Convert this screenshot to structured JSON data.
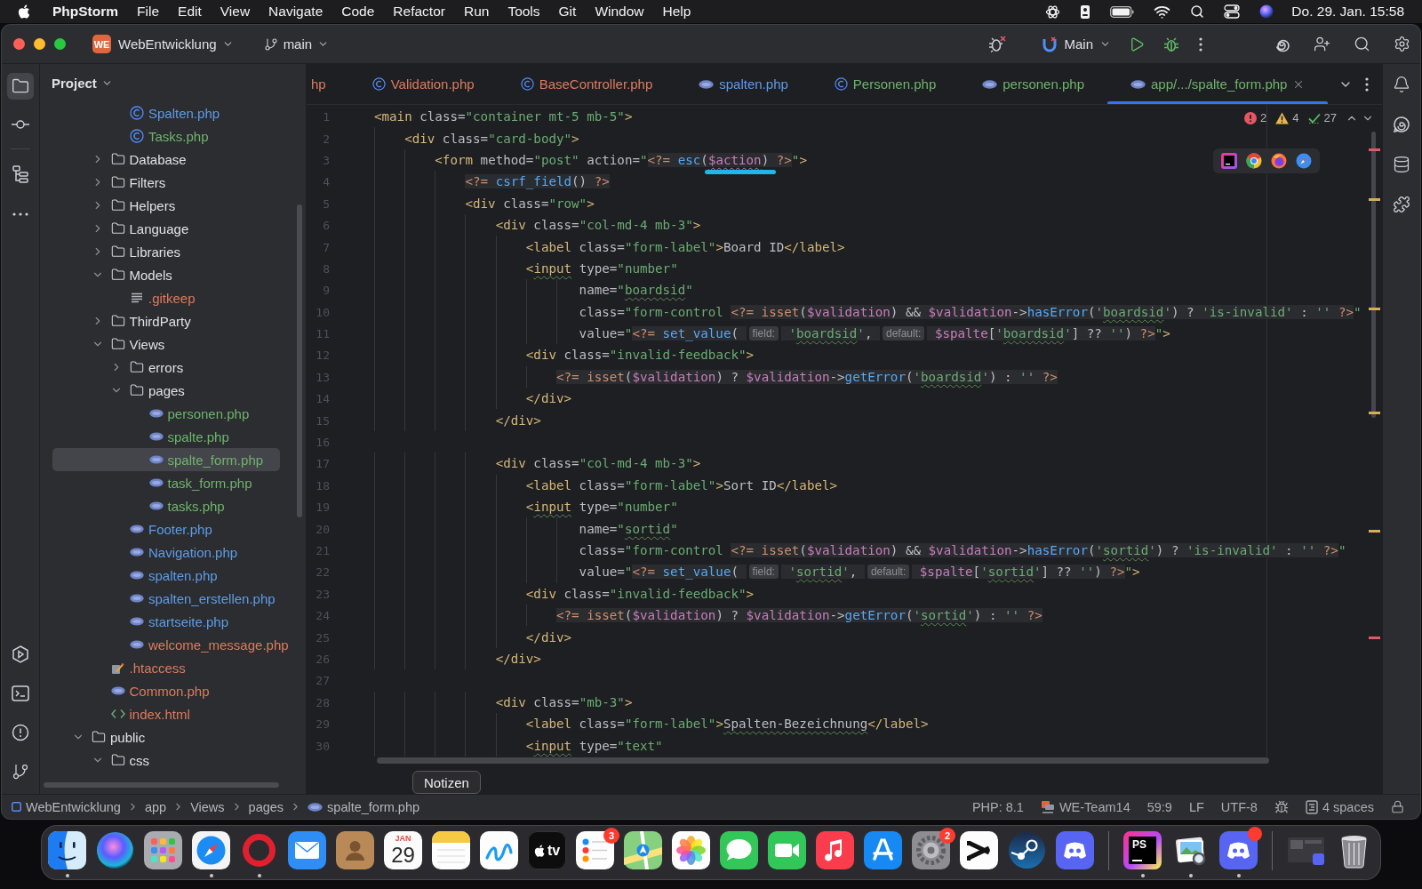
{
  "menu_bar": {
    "app": "PhpStorm",
    "menus": [
      "File",
      "Edit",
      "View",
      "Navigate",
      "Code",
      "Refactor",
      "Run",
      "Tools",
      "Git",
      "Window",
      "Help"
    ],
    "clock": "Do. 29. Jan. 15:58"
  },
  "toolbar": {
    "project_badge": "WE",
    "project": "WebEntwicklung",
    "branch": "main",
    "run_config": "Main"
  },
  "tool_strip_left": {
    "top": [
      {
        "kind": "project",
        "selected": true
      },
      {
        "kind": "commit",
        "selected": false
      },
      {
        "kind": "structure",
        "selected": false
      },
      {
        "kind": "more",
        "selected": false
      }
    ],
    "bottom": [
      {
        "kind": "services",
        "selected": false
      },
      {
        "kind": "terminal",
        "selected": false
      },
      {
        "kind": "problems",
        "selected": false
      },
      {
        "kind": "git",
        "selected": false
      }
    ]
  },
  "project_panel": {
    "title": "Project",
    "tree": [
      {
        "children": [
          {
            "children": [
              {
                "label": "Spalten.php",
                "kind": "class",
                "color": "#5e9ce8",
                "selected": false
              },
              {
                "label": "Tasks.php",
                "kind": "class",
                "color": "#6fb36c",
                "selected": false
              }
            ]
          },
          {
            "label": "Database",
            "kind": "folder",
            "expanded": false,
            "selected": false
          },
          {
            "label": "Filters",
            "kind": "folder",
            "expanded": false,
            "selected": false
          },
          {
            "label": "Helpers",
            "kind": "folder",
            "expanded": false,
            "selected": false
          },
          {
            "label": "Language",
            "kind": "folder",
            "expanded": false,
            "selected": false
          },
          {
            "label": "Libraries",
            "kind": "folder",
            "expanded": false,
            "selected": false
          },
          {
            "label": "Models",
            "kind": "folder",
            "expanded": true,
            "selected": false,
            "children": [
              {
                "label": ".gitkeep",
                "kind": "text",
                "color": "#dc7b5f",
                "selected": false
              }
            ]
          },
          {
            "label": "ThirdParty",
            "kind": "folder",
            "expanded": false,
            "selected": false
          },
          {
            "label": "Views",
            "kind": "folder",
            "expanded": true,
            "selected": false,
            "children": [
              {
                "label": "errors",
                "kind": "folder",
                "expanded": false,
                "selected": false
              },
              {
                "label": "pages",
                "kind": "folder",
                "expanded": true,
                "selected": false,
                "children": [
                  {
                    "label": "personen.php",
                    "kind": "php",
                    "color": "#6fb36c",
                    "selected": false
                  },
                  {
                    "label": "spalte.php",
                    "kind": "php",
                    "color": "#6fb36c",
                    "selected": false
                  },
                  {
                    "label": "spalte_form.php",
                    "kind": "php",
                    "color": "#6fb36c",
                    "selected": true
                  },
                  {
                    "label": "task_form.php",
                    "kind": "php",
                    "color": "#6fb36c",
                    "selected": false
                  },
                  {
                    "label": "tasks.php",
                    "kind": "php",
                    "color": "#6fb36c",
                    "selected": false
                  }
                ]
              },
              {
                "label": "Footer.php",
                "kind": "php",
                "color": "#5e9ce8",
                "selected": false
              },
              {
                "label": "Navigation.php",
                "kind": "php",
                "color": "#5e9ce8",
                "selected": false
              },
              {
                "label": "spalten.php",
                "kind": "php",
                "color": "#5e9ce8",
                "selected": false
              },
              {
                "label": "spalten_erstellen.php",
                "kind": "php",
                "color": "#5e9ce8",
                "selected": false
              },
              {
                "label": "startseite.php",
                "kind": "php",
                "color": "#5e9ce8",
                "selected": false
              },
              {
                "label": "welcome_message.php",
                "kind": "php",
                "color": "#dc7b5f",
                "selected": false
              }
            ]
          },
          {
            "label": ".htaccess",
            "kind": "config",
            "color": "#dc7b5f",
            "selected": false
          },
          {
            "label": "Common.php",
            "kind": "php",
            "color": "#dc7b5f",
            "selected": false
          },
          {
            "label": "index.html",
            "kind": "html",
            "color": "#dc7b5f",
            "selected": false
          }
        ]
      },
      {
        "label": "public",
        "kind": "folder",
        "expanded": true,
        "selected": false,
        "children": [
          {
            "label": "css",
            "kind": "folder",
            "expanded": true,
            "selected": false
          }
        ]
      }
    ]
  },
  "editor": {
    "tabs": [
      {
        "label": "hp",
        "color": "#dc7b5f",
        "selected": false
      },
      {
        "label": "Validation.php",
        "kind": "class",
        "color": "#dc7b5f",
        "selected": false
      },
      {
        "label": "BaseController.php",
        "kind": "class",
        "color": "#dc7b5f",
        "selected": false
      },
      {
        "label": "spalten.php",
        "kind": "php",
        "color": "#5e9ce8",
        "selected": false
      },
      {
        "label": "Personen.php",
        "kind": "class",
        "color": "#6fb36c",
        "selected": false
      },
      {
        "label": "personen.php",
        "kind": "php",
        "color": "#6fb36c",
        "selected": false
      },
      {
        "label": "app/.../spalte_form.php",
        "kind": "php",
        "color": "#6fb36c",
        "selected": true
      }
    ],
    "inspections": {
      "errors": "2",
      "warnings": "4",
      "checks": "27"
    },
    "lines": [
      {
        "number": "1",
        "tokens": [
          {
            "text": "<main",
            "kind": "tag"
          },
          {
            "text": " class=",
            "kind": "attr"
          },
          {
            "text": "\"container mt-5 mb-5\"",
            "kind": "str"
          },
          {
            "text": ">",
            "kind": "tag"
          }
        ]
      },
      {
        "number": "2",
        "tokens": [
          {
            "text": "    <div",
            "kind": "tag"
          },
          {
            "text": " class=",
            "kind": "attr"
          },
          {
            "text": "\"card-body\"",
            "kind": "str"
          },
          {
            "text": ">",
            "kind": "tag"
          }
        ]
      },
      {
        "number": "3",
        "tokens": [
          {
            "text": "        <form",
            "kind": "tag"
          },
          {
            "text": " method=",
            "kind": "attr"
          },
          {
            "text": "\"post\"",
            "kind": "str"
          },
          {
            "text": " action=",
            "kind": "attr"
          },
          {
            "text": "\"",
            "kind": "str"
          },
          {
            "text": "<?= ",
            "kind": "php"
          },
          {
            "text": "esc",
            "kind": "fn"
          },
          {
            "text": "(",
            "kind": "op"
          },
          {
            "text": "$action",
            "kind": "var_found"
          },
          {
            "text": ") ",
            "kind": "op"
          },
          {
            "text": "?>",
            "kind": "php"
          },
          {
            "text": "\"",
            "kind": "str"
          },
          {
            "text": ">",
            "kind": "tag"
          }
        ]
      },
      {
        "number": "4",
        "tokens": [
          {
            "text": "            <?= ",
            "kind": "php"
          },
          {
            "text": "csrf_field",
            "kind": "fn"
          },
          {
            "text": "() ",
            "kind": "op"
          },
          {
            "text": "?>",
            "kind": "php"
          }
        ]
      },
      {
        "number": "5",
        "tokens": [
          {
            "text": "            <div",
            "kind": "tag"
          },
          {
            "text": " class=",
            "kind": "attr"
          },
          {
            "text": "\"row\"",
            "kind": "str"
          },
          {
            "text": ">",
            "kind": "tag"
          }
        ]
      },
      {
        "number": "6",
        "tokens": [
          {
            "text": "                <div",
            "kind": "tag"
          },
          {
            "text": " class=",
            "kind": "attr"
          },
          {
            "text": "\"col-md-4 mb-3\"",
            "kind": "str"
          },
          {
            "text": ">",
            "kind": "tag"
          }
        ]
      },
      {
        "number": "7",
        "tokens": [
          {
            "text": "                    <label",
            "kind": "tag"
          },
          {
            "text": " class=",
            "kind": "attr"
          },
          {
            "text": "\"form-label\"",
            "kind": "str"
          },
          {
            "text": ">",
            "kind": "tag"
          },
          {
            "text": "Board ID",
            "kind": "text"
          },
          {
            "text": "</label>",
            "kind": "tag"
          }
        ]
      },
      {
        "number": "8",
        "tokens": [
          {
            "text": "                    <",
            "kind": "tag"
          },
          {
            "text": "input",
            "kind": "tag_typo"
          },
          {
            "text": " type=",
            "kind": "attr"
          },
          {
            "text": "\"number\"",
            "kind": "str"
          }
        ]
      },
      {
        "number": "9",
        "tokens": [
          {
            "text": "                           name=",
            "kind": "attr"
          },
          {
            "text": "\"",
            "kind": "str"
          },
          {
            "text": "boardsid",
            "kind": "str_typo"
          },
          {
            "text": "\"",
            "kind": "str"
          }
        ]
      },
      {
        "number": "10",
        "tokens": [
          {
            "text": "                           class=",
            "kind": "attr"
          },
          {
            "text": "\"form-control ",
            "kind": "str"
          },
          {
            "text": "<?= isset",
            "kind": "php"
          },
          {
            "text": "(",
            "kind": "op"
          },
          {
            "text": "$validation",
            "kind": "var"
          },
          {
            "text": ") && ",
            "kind": "op"
          },
          {
            "text": "$validation",
            "kind": "var"
          },
          {
            "text": "->",
            "kind": "op"
          },
          {
            "text": "hasError",
            "kind": "fn"
          },
          {
            "text": "(",
            "kind": "op"
          },
          {
            "text": "'",
            "kind": "pstr"
          },
          {
            "text": "boardsid",
            "kind": "pstr_typo"
          },
          {
            "text": "'",
            "kind": "pstr"
          },
          {
            "text": ") ? ",
            "kind": "op"
          },
          {
            "text": "'is-invalid'",
            "kind": "pstr"
          },
          {
            "text": " : ",
            "kind": "op"
          },
          {
            "text": "''",
            "kind": "pstr"
          },
          {
            "text": " ?>",
            "kind": "php"
          },
          {
            "text": "\"",
            "kind": "str"
          }
        ]
      },
      {
        "number": "11",
        "tokens": [
          {
            "text": "                           value=",
            "kind": "attr"
          },
          {
            "text": "\"",
            "kind": "str"
          },
          {
            "text": "<?= ",
            "kind": "php"
          },
          {
            "text": "set_value",
            "kind": "fn"
          },
          {
            "text": "( ",
            "kind": "op"
          },
          {
            "text": "field:",
            "kind": "hint"
          },
          {
            "text": " '",
            "kind": "pstr"
          },
          {
            "text": "boardsid",
            "kind": "pstr_typo"
          },
          {
            "text": "'",
            "kind": "pstr"
          },
          {
            "text": ", ",
            "kind": "op"
          },
          {
            "text": "default:",
            "kind": "hint"
          },
          {
            "text": " $spalte",
            "kind": "var"
          },
          {
            "text": "[",
            "kind": "op"
          },
          {
            "text": "'",
            "kind": "pstr"
          },
          {
            "text": "boardsid",
            "kind": "pstr_typo"
          },
          {
            "text": "'",
            "kind": "pstr"
          },
          {
            "text": "] ?? ",
            "kind": "op"
          },
          {
            "text": "''",
            "kind": "pstr"
          },
          {
            "text": ") ",
            "kind": "op"
          },
          {
            "text": "?>",
            "kind": "php"
          },
          {
            "text": "\"",
            "kind": "str"
          },
          {
            "text": ">",
            "kind": "tag"
          }
        ]
      },
      {
        "number": "12",
        "tokens": [
          {
            "text": "                    <div",
            "kind": "tag"
          },
          {
            "text": " class=",
            "kind": "attr"
          },
          {
            "text": "\"invalid-feedback\"",
            "kind": "str"
          },
          {
            "text": ">",
            "kind": "tag"
          }
        ]
      },
      {
        "number": "13",
        "tokens": [
          {
            "text": "                        <?= isset",
            "kind": "php"
          },
          {
            "text": "(",
            "kind": "op"
          },
          {
            "text": "$validation",
            "kind": "var"
          },
          {
            "text": ") ? ",
            "kind": "op"
          },
          {
            "text": "$validation",
            "kind": "var"
          },
          {
            "text": "->",
            "kind": "op"
          },
          {
            "text": "getError",
            "kind": "fn"
          },
          {
            "text": "(",
            "kind": "op"
          },
          {
            "text": "'",
            "kind": "pstr"
          },
          {
            "text": "boardsid",
            "kind": "pstr_typo"
          },
          {
            "text": "'",
            "kind": "pstr"
          },
          {
            "text": ") : ",
            "kind": "op"
          },
          {
            "text": "''",
            "kind": "pstr"
          },
          {
            "text": " ?>",
            "kind": "php"
          }
        ]
      },
      {
        "number": "14",
        "tokens": [
          {
            "text": "                    </div>",
            "kind": "tag"
          }
        ]
      },
      {
        "number": "15",
        "tokens": [
          {
            "text": "                </div>",
            "kind": "tag"
          }
        ]
      },
      {
        "number": "16"
      },
      {
        "number": "17",
        "tokens": [
          {
            "text": "                <div",
            "kind": "tag"
          },
          {
            "text": " class=",
            "kind": "attr"
          },
          {
            "text": "\"col-md-4 mb-3\"",
            "kind": "str"
          },
          {
            "text": ">",
            "kind": "tag"
          }
        ]
      },
      {
        "number": "18",
        "tokens": [
          {
            "text": "                    <label",
            "kind": "tag"
          },
          {
            "text": " class=",
            "kind": "attr"
          },
          {
            "text": "\"form-label\"",
            "kind": "str"
          },
          {
            "text": ">",
            "kind": "tag"
          },
          {
            "text": "Sort ID",
            "kind": "text"
          },
          {
            "text": "</label>",
            "kind": "tag"
          }
        ]
      },
      {
        "number": "19",
        "tokens": [
          {
            "text": "                    <",
            "kind": "tag"
          },
          {
            "text": "input",
            "kind": "tag_typo"
          },
          {
            "text": " type=",
            "kind": "attr"
          },
          {
            "text": "\"number\"",
            "kind": "str"
          }
        ]
      },
      {
        "number": "20",
        "tokens": [
          {
            "text": "                           name=",
            "kind": "attr"
          },
          {
            "text": "\"",
            "kind": "str"
          },
          {
            "text": "sortid",
            "kind": "str_typo"
          },
          {
            "text": "\"",
            "kind": "str"
          }
        ]
      },
      {
        "number": "21",
        "tokens": [
          {
            "text": "                           class=",
            "kind": "attr"
          },
          {
            "text": "\"form-control ",
            "kind": "str"
          },
          {
            "text": "<?= isset",
            "kind": "php"
          },
          {
            "text": "(",
            "kind": "op"
          },
          {
            "text": "$validation",
            "kind": "var"
          },
          {
            "text": ") && ",
            "kind": "op"
          },
          {
            "text": "$validation",
            "kind": "var"
          },
          {
            "text": "->",
            "kind": "op"
          },
          {
            "text": "hasError",
            "kind": "fn"
          },
          {
            "text": "(",
            "kind": "op"
          },
          {
            "text": "'",
            "kind": "pstr"
          },
          {
            "text": "sortid",
            "kind": "pstr_typo"
          },
          {
            "text": "'",
            "kind": "pstr"
          },
          {
            "text": ") ? ",
            "kind": "op"
          },
          {
            "text": "'is-invalid'",
            "kind": "pstr"
          },
          {
            "text": " : ",
            "kind": "op"
          },
          {
            "text": "''",
            "kind": "pstr"
          },
          {
            "text": " ?>",
            "kind": "php"
          },
          {
            "text": "\"",
            "kind": "str"
          }
        ]
      },
      {
        "number": "22",
        "tokens": [
          {
            "text": "                           value=",
            "kind": "attr"
          },
          {
            "text": "\"",
            "kind": "str"
          },
          {
            "text": "<?= ",
            "kind": "php"
          },
          {
            "text": "set_value",
            "kind": "fn"
          },
          {
            "text": "( ",
            "kind": "op"
          },
          {
            "text": "field:",
            "kind": "hint"
          },
          {
            "text": " '",
            "kind": "pstr"
          },
          {
            "text": "sortid",
            "kind": "pstr_typo"
          },
          {
            "text": "'",
            "kind": "pstr"
          },
          {
            "text": ", ",
            "kind": "op"
          },
          {
            "text": "default:",
            "kind": "hint"
          },
          {
            "text": " $spalte",
            "kind": "var"
          },
          {
            "text": "[",
            "kind": "op"
          },
          {
            "text": "'",
            "kind": "pstr"
          },
          {
            "text": "sortid",
            "kind": "pstr_typo"
          },
          {
            "text": "'",
            "kind": "pstr"
          },
          {
            "text": "] ?? ",
            "kind": "op"
          },
          {
            "text": "''",
            "kind": "pstr"
          },
          {
            "text": ") ",
            "kind": "op"
          },
          {
            "text": "?>",
            "kind": "php"
          },
          {
            "text": "\"",
            "kind": "str"
          },
          {
            "text": ">",
            "kind": "tag"
          }
        ]
      },
      {
        "number": "23",
        "tokens": [
          {
            "text": "                    <div",
            "kind": "tag"
          },
          {
            "text": " class=",
            "kind": "attr"
          },
          {
            "text": "\"invalid-feedback\"",
            "kind": "str"
          },
          {
            "text": ">",
            "kind": "tag"
          }
        ]
      },
      {
        "number": "24",
        "tokens": [
          {
            "text": "                        <?= isset",
            "kind": "php"
          },
          {
            "text": "(",
            "kind": "op"
          },
          {
            "text": "$validation",
            "kind": "var"
          },
          {
            "text": ") ? ",
            "kind": "op"
          },
          {
            "text": "$validation",
            "kind": "var"
          },
          {
            "text": "->",
            "kind": "op"
          },
          {
            "text": "getError",
            "kind": "fn"
          },
          {
            "text": "(",
            "kind": "op"
          },
          {
            "text": "'",
            "kind": "pstr"
          },
          {
            "text": "sortid",
            "kind": "pstr_typo"
          },
          {
            "text": "'",
            "kind": "pstr"
          },
          {
            "text": ") : ",
            "kind": "op"
          },
          {
            "text": "''",
            "kind": "pstr"
          },
          {
            "text": " ?>",
            "kind": "php"
          }
        ]
      },
      {
        "number": "25",
        "tokens": [
          {
            "text": "                    </div>",
            "kind": "tag"
          }
        ]
      },
      {
        "number": "26",
        "tokens": [
          {
            "text": "                </div>",
            "kind": "tag"
          }
        ]
      },
      {
        "number": "27"
      },
      {
        "number": "28",
        "tokens": [
          {
            "text": "                <div",
            "kind": "tag"
          },
          {
            "text": " class=",
            "kind": "attr"
          },
          {
            "text": "\"mb-3\"",
            "kind": "str"
          },
          {
            "text": ">",
            "kind": "tag"
          }
        ]
      },
      {
        "number": "29",
        "tokens": [
          {
            "text": "                    <label",
            "kind": "tag"
          },
          {
            "text": " class=",
            "kind": "attr"
          },
          {
            "text": "\"form-label\"",
            "kind": "str"
          },
          {
            "text": ">",
            "kind": "tag"
          },
          {
            "text": "Spalten-Bezeichnung",
            "kind": "text_typo"
          },
          {
            "text": "</label>",
            "kind": "tag"
          }
        ]
      },
      {
        "number": "30",
        "tokens": [
          {
            "text": "                    <",
            "kind": "tag"
          },
          {
            "text": "input",
            "kind": "tag_typo"
          },
          {
            "text": " type=",
            "kind": "attr"
          },
          {
            "text": "\"text\"",
            "kind": "str"
          }
        ]
      }
    ]
  },
  "tool_strip_right": [
    {
      "kind": "notifications"
    },
    {
      "kind": "ai_chat"
    },
    {
      "kind": "database"
    },
    {
      "kind": "plugin"
    }
  ],
  "status_bar": {
    "breadcrumbs": [
      {
        "label": "WebEntwicklung",
        "kind": "project"
      },
      {
        "label": "app",
        "kind": "folder"
      },
      {
        "label": "Views",
        "kind": "folder"
      },
      {
        "label": "pages",
        "kind": "folder"
      },
      {
        "label": "spalte_form.php",
        "kind": "php"
      }
    ],
    "items": [
      {
        "kind": "text",
        "label": "PHP: 8.1"
      },
      {
        "kind": "ssh",
        "label": "WE-Team14"
      },
      {
        "kind": "text",
        "label": "59:9"
      },
      {
        "kind": "text",
        "label": "LF"
      },
      {
        "kind": "text",
        "label": "UTF-8"
      },
      {
        "kind": "bug"
      },
      {
        "kind": "indent",
        "label": "4 spaces"
      },
      {
        "kind": "lock"
      }
    ]
  },
  "dock": {
    "items": [
      {
        "kind": "finder",
        "running": true
      },
      {
        "kind": "siri",
        "running": false
      },
      {
        "kind": "launchpad",
        "running": false
      },
      {
        "kind": "safari",
        "running": true
      },
      {
        "kind": "opera",
        "running": true
      },
      {
        "kind": "mail",
        "running": false
      },
      {
        "kind": "contacts",
        "running": false
      },
      {
        "kind": "calendar",
        "running": false,
        "month": "JAN",
        "day": "29"
      },
      {
        "kind": "notes",
        "running": false
      },
      {
        "kind": "freeform",
        "running": false
      },
      {
        "kind": "tv",
        "running": false,
        "label": "tv"
      },
      {
        "kind": "reminders",
        "running": false,
        "badge": "3"
      },
      {
        "kind": "maps",
        "running": false
      },
      {
        "kind": "photos",
        "running": false
      },
      {
        "kind": "messages",
        "running": false
      },
      {
        "kind": "facetime",
        "running": false
      },
      {
        "kind": "music",
        "running": false
      },
      {
        "kind": "appstore",
        "running": false
      },
      {
        "kind": "settings",
        "running": false,
        "badge": "2"
      },
      {
        "kind": "capcut",
        "running": false
      },
      {
        "kind": "steam",
        "running": false
      },
      {
        "kind": "discord",
        "running": false,
        "alert": false
      },
      {
        "kind": "separator"
      },
      {
        "kind": "phpstorm",
        "running": true,
        "label": "PS"
      },
      {
        "kind": "preview",
        "running": true
      },
      {
        "kind": "discord",
        "running": true,
        "alert": true
      },
      {
        "kind": "separator"
      },
      {
        "kind": "screenshot",
        "running": false
      },
      {
        "kind": "trash",
        "running": false
      }
    ]
  },
  "tooltip": {
    "text": "Notizen"
  }
}
